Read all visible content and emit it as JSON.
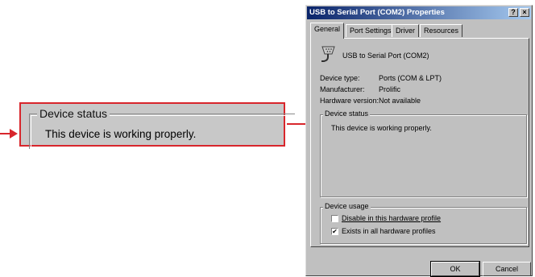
{
  "callout": {
    "group_title": "Device status",
    "status_text": "This device is working properly."
  },
  "dialog": {
    "title": "USB to Serial Port (COM2) Properties",
    "help_glyph": "?",
    "close_glyph": "×",
    "tabs": [
      {
        "label": "General",
        "active": true
      },
      {
        "label": "Port Settings",
        "active": false
      },
      {
        "label": "Driver",
        "active": false
      },
      {
        "label": "Resources",
        "active": false
      }
    ],
    "device_name": "USB to Serial Port (COM2)",
    "device_icon": "serial-port-icon",
    "properties": [
      {
        "label": "Device type:",
        "value": "Ports (COM & LPT)"
      },
      {
        "label": "Manufacturer:",
        "value": "Prolific"
      },
      {
        "label": "Hardware version:",
        "value": "Not available"
      }
    ],
    "device_status": {
      "title": "Device status",
      "text": "This device is working properly."
    },
    "device_usage": {
      "title": "Device usage",
      "options": [
        {
          "label": "Disable in this hardware profile",
          "checked": false
        },
        {
          "label": "Exists in all hardware profiles",
          "checked": true
        }
      ]
    },
    "buttons": {
      "ok": "OK",
      "cancel": "Cancel"
    },
    "accent_color": "#d8262c",
    "title_bar_color": "#0a246a"
  }
}
